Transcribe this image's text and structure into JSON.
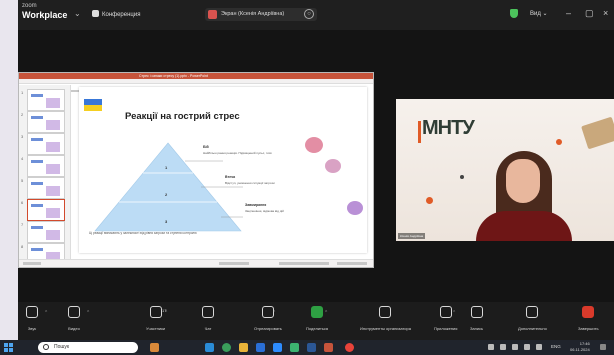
{
  "window": {
    "app_small": "zoom",
    "app_big": "Workplace",
    "conference_label": "Конференция",
    "share_label": "Экран (Ксенія Андріївна)",
    "view_label": "Вид"
  },
  "app": {
    "title": "Стрес і ознаки стресу (1).pptx - PowerPoint"
  },
  "slide": {
    "title": "Реакції на гострий стрес",
    "levels": [
      {
        "num": "1",
        "label": "Бій",
        "desc": "Найбільш рання реакція. Підвищений пульс, тиск"
      },
      {
        "num": "2",
        "label": "Втеча",
        "desc": "Відступ, уникнення ситуації загрози"
      },
      {
        "num": "3",
        "label": "Завмирання",
        "desc": "Заціпеніння, відмова від дій"
      }
    ],
    "note": "Ці реакції виникають у залежності від рівня загрози та ступеня контролю"
  },
  "thumbs": [
    "1",
    "2",
    "3",
    "4",
    "5",
    "6",
    "7",
    "8"
  ],
  "camera": {
    "logo_text": "МНТУ",
    "name": "Ксенія Андріївна"
  },
  "toolbar": [
    {
      "name": "mic",
      "label": "Звук",
      "caret": true
    },
    {
      "name": "video",
      "label": "Видео",
      "caret": true
    },
    {
      "name": "participants",
      "label": "Участники",
      "count": "17",
      "caret": true
    },
    {
      "name": "chat",
      "label": "Чат",
      "caret": false
    },
    {
      "name": "react",
      "label": "Отреагировать",
      "caret": true
    },
    {
      "name": "share",
      "label": "Поделиться",
      "caret": true
    },
    {
      "name": "host-tools",
      "label": "Инструменты организатора",
      "caret": false
    },
    {
      "name": "apps",
      "label": "Приложения",
      "caret": true
    },
    {
      "name": "record",
      "label": "Запись",
      "caret": false
    },
    {
      "name": "more",
      "label": "Дополнительно",
      "caret": false
    },
    {
      "name": "end",
      "label": "Завершить",
      "caret": false
    }
  ],
  "taskbar": {
    "search_placeholder": "Пошук",
    "time": "17:46",
    "date": "06.11.2024",
    "lang": "ENG"
  },
  "colors": {
    "zoom_bg": "#141414",
    "pyramid": "#bcdcf5",
    "end": "#d93a2b",
    "share_green": "#2ea043"
  }
}
